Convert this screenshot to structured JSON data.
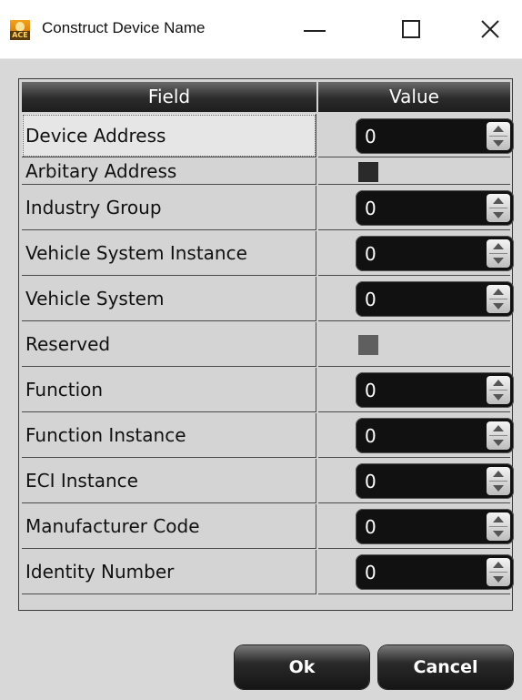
{
  "window": {
    "title": "Construct Device Name",
    "icon": "app-logo-icon",
    "icon_text": "ACE"
  },
  "grid": {
    "columns": [
      "Field",
      "Value"
    ],
    "rows": [
      {
        "field": "Device Address",
        "type": "spin",
        "value": "0",
        "selected": true
      },
      {
        "field": "Arbitary Address",
        "type": "checkbox",
        "checked": false
      },
      {
        "field": "Industry Group",
        "type": "spin",
        "value": "0"
      },
      {
        "field": "Vehicle System Instance",
        "type": "spin",
        "value": "0"
      },
      {
        "field": "Vehicle System",
        "type": "spin",
        "value": "0"
      },
      {
        "field": "Reserved",
        "type": "checkbox",
        "checked": false,
        "disabled": true
      },
      {
        "field": "Function",
        "type": "spin",
        "value": "0"
      },
      {
        "field": "Function Instance",
        "type": "spin",
        "value": "0"
      },
      {
        "field": "ECI Instance",
        "type": "spin",
        "value": "0"
      },
      {
        "field": "Manufacturer Code",
        "type": "spin",
        "value": "0"
      },
      {
        "field": "Identity Number",
        "type": "spin",
        "value": "0"
      }
    ]
  },
  "buttons": {
    "ok": "Ok",
    "cancel": "Cancel"
  },
  "colors": {
    "header_bg": "#2b2b2b",
    "spin_bg": "#111111",
    "dialog_bg": "#d8d8d8"
  }
}
